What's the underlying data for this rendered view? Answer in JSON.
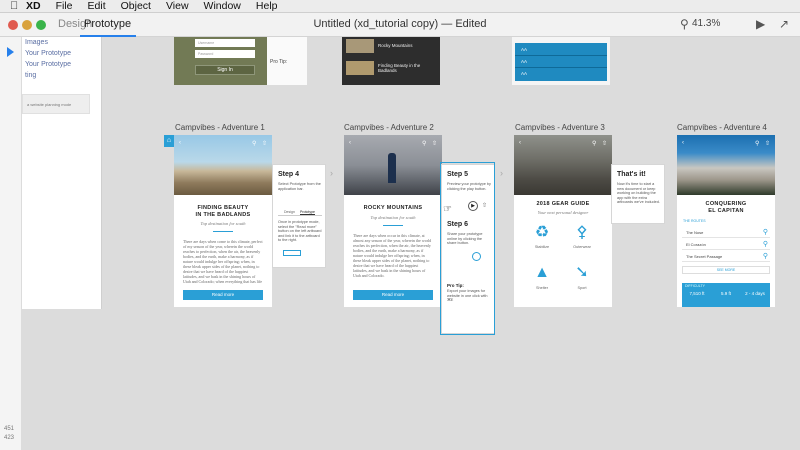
{
  "menubar": {
    "apple": "",
    "app": "XD",
    "items": [
      "File",
      "Edit",
      "Object",
      "View",
      "Window",
      "Help"
    ]
  },
  "titlebar": {
    "tabs": [
      "Design",
      "Prototype"
    ],
    "active_tab": "Prototype",
    "doc_title": "Untitled (xd_tutorial copy) — Edited",
    "zoom": "41.3%"
  },
  "toolstrip": {
    "coord_x": "451",
    "coord_y": "423"
  },
  "left_panel": {
    "items": [
      "Images",
      "Your Prototype",
      "Your Prototype",
      "ting"
    ],
    "note": "a website planning mode"
  },
  "top_artboards": {
    "signin_label": "Sign In",
    "field_labels": [
      "Username",
      "Password"
    ],
    "pro_tip": "Pro Tip:",
    "dark_card_1": "Rocky Mountains",
    "dark_card_2": "Finding Beauty in the Badlands",
    "blue_labels": [
      "AA",
      "AA",
      "AA"
    ]
  },
  "artboards": [
    {
      "label": "Campvibes - Adventure 1",
      "title_line1": "FINDING BEAUTY",
      "title_line2": "IN THE BADLANDS",
      "subtitle": "Top destination for south",
      "body": "There are days when come to this climate, perfect of my season of the year, wherein the world reaches to perfection, when the air, the heavenly bodies, and the earth, make a harmony, as if nature would indulge her offspring; when, in these bleak upper sides of the planet, nothing to desire that we have heard of the happiest latitudes, and we bask in the shining hours of Utah and Colorado; when everything that has life gives sign of satisfaction.",
      "button": "Read more"
    },
    {
      "label": "Campvibes - Adventure 2",
      "title_line1": "ROCKY MOUNTAINS",
      "title_line2": "",
      "subtitle": "Top destination for south",
      "body": "There are days when occur in this climate, at almost any season of the year, wherein the world reaches its perfection, when the air, the heavenly bodies, and the earth, make a harmony, as if nature would indulge her offspring; when, in these bleak upper sides of the planet, nothing to desire that we have heard of the happiest latitudes, and we bask in the shining hours of Utah and Colorado.",
      "button": "Read more"
    },
    {
      "label": "Campvibes - Adventure 3",
      "title_line1": "2018 GEAR GUIDE",
      "title_line2": "",
      "subtitle": "Your next personal designer",
      "gear": [
        "Stabilize",
        "Outerwear",
        "Shelter",
        "Sport"
      ]
    },
    {
      "label": "Campvibes - Adventure 4",
      "title_line1": "CONQUERING",
      "title_line2": "EL CAPITAN",
      "list_header": "THE ROUTES",
      "routes": [
        "The Nose",
        "El Corazón",
        "The Secret Passage"
      ],
      "see_more": "SEE MORE",
      "stats_header": "DIFFICULTY",
      "stats": [
        "7,510 ft",
        "5.9 ft",
        "2 - 4 days"
      ]
    }
  ],
  "tips": [
    {
      "title": "Step 4",
      "text": "Select Prototype from the application bar.",
      "toggle": [
        "Design",
        "Prototype"
      ],
      "text2": "Once in prototype mode, select the \"Read more\" button on the left artboard and link it to the artboard to the right."
    },
    {
      "title": "Step 5",
      "text": "Preview your prototype by clicking the play button.",
      "title2": "Step 6",
      "text2": "Share your prototype online by clicking the share button.",
      "pro_tip": "Pro Tip:",
      "pro_text": "Export your images for website in one click with ⌘E"
    },
    {
      "title": "That's it!",
      "text": "Now it's time to start a new document or keep working on building the app with the extra artboards we've included."
    }
  ]
}
